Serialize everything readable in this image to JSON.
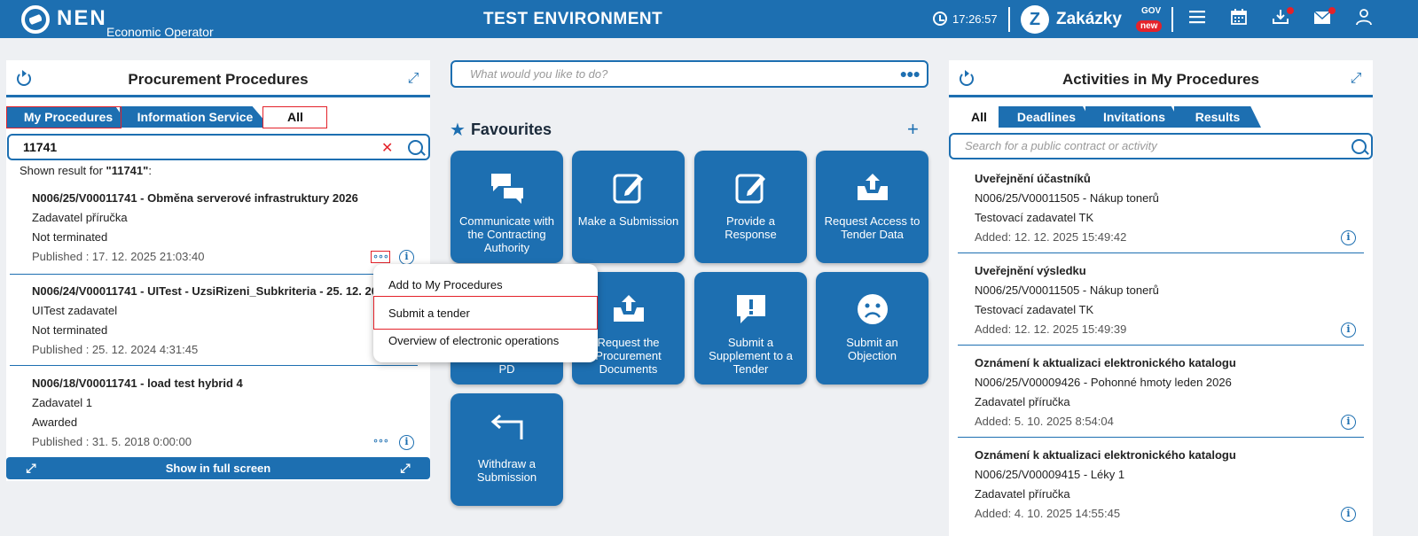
{
  "header": {
    "logo_text": "NEN",
    "logo_sub": "Economic Operator",
    "environment": "TEST ENVIRONMENT",
    "time": "17:26:57",
    "zakazky_label": "Zakázky",
    "zakazky_gov": "GOV",
    "zakazky_new": "new"
  },
  "left": {
    "title": "Procurement Procedures",
    "tabs": [
      "My Procedures",
      "Information Service",
      "All"
    ],
    "search_value": "11741",
    "result_prefix": "Shown result for ",
    "result_query": "\"11741\"",
    "result_suffix": ":",
    "procedures": [
      {
        "title": "N006/25/V00011741 - Obměna serverové infrastruktury 2026",
        "authority": "Zadavatel příručka",
        "status": "Not terminated",
        "published": "Published : 17. 12. 2025 21:03:40"
      },
      {
        "title": "N006/24/V00011741 - UITest - UzsiRizeni_Subkriteria - 25. 12. 2024",
        "authority": "UITest zadavatel",
        "status": "Not terminated",
        "published": "Published : 25. 12. 2024 4:31:45"
      },
      {
        "title": "N006/18/V00011741 - load test hybrid 4",
        "authority": "Zadavatel 1",
        "status": "Awarded",
        "published": "Published : 31. 5. 2018 0:00:00"
      }
    ],
    "fullscreen_label": "Show in full screen"
  },
  "popup": {
    "items": [
      "Add to My Procedures",
      "Submit a tender",
      "Overview of electronic operations"
    ]
  },
  "center": {
    "search_placeholder": "What would you like to do?",
    "favourites_title": "Favourites",
    "tiles": [
      "Communicate with the Contracting Authority",
      "Make a Submission",
      "Provide a Response",
      "Request Access to Tender Data",
      "PD",
      "Request the Procurement Documents",
      "Submit a Supplement to a Tender",
      "Submit an Objection",
      "Withdraw a Submission"
    ]
  },
  "right": {
    "title": "Activities in My Procedures",
    "tabs": [
      "All",
      "Deadlines",
      "Invitations",
      "Results"
    ],
    "search_placeholder": "Search for a public contract or activity",
    "activities": [
      {
        "title": "Uveřejnění účastníků",
        "contract": "N006/25/V00011505 - Nákup tonerů",
        "authority": "Testovací zadavatel TK",
        "added": "Added: 12. 12. 2025 15:49:42"
      },
      {
        "title": "Uveřejnění výsledku",
        "contract": "N006/25/V00011505 - Nákup tonerů",
        "authority": "Testovací zadavatel TK",
        "added": "Added: 12. 12. 2025 15:49:39"
      },
      {
        "title": "Oznámení k aktualizaci elektronického katalogu",
        "contract": "N006/25/V00009426 - Pohonné hmoty leden 2026",
        "authority": "Zadavatel příručka",
        "added": "Added: 5. 10. 2025 8:54:04"
      },
      {
        "title": "Oznámení k aktualizaci elektronického katalogu",
        "contract": "N006/25/V00009415 - Léky 1",
        "authority": "Zadavatel příručka",
        "added": "Added: 4. 10. 2025 14:55:45"
      }
    ]
  },
  "colors": {
    "primary": "#1d6fb1",
    "highlight": "#e4222a"
  }
}
